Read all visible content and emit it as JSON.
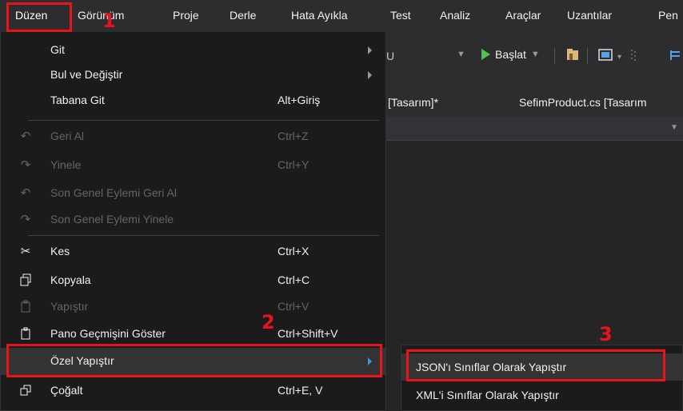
{
  "menubar": {
    "items": [
      "Düzen",
      "Görünüm",
      "Proje",
      "Derle",
      "Hata Ayıkla",
      "Test",
      "Analiz",
      "Araçlar",
      "Uzantılar",
      "Pen"
    ]
  },
  "toolbar": {
    "config_combo_text": "U",
    "start_label": "Başlat"
  },
  "tabs": [
    "[Tasarım]*",
    "SefimProduct.cs [Tasarım"
  ],
  "edit_menu": {
    "items": [
      {
        "label": "Git",
        "shortcut": "",
        "submenu": true,
        "enabled": true,
        "icon": ""
      },
      {
        "label": "Bul ve Değiştir",
        "shortcut": "",
        "submenu": true,
        "enabled": true,
        "icon": ""
      },
      {
        "label": "Tabana Git",
        "shortcut": "Alt+Giriş",
        "submenu": false,
        "enabled": true,
        "icon": ""
      },
      {
        "label": "Geri Al",
        "shortcut": "Ctrl+Z",
        "submenu": false,
        "enabled": false,
        "icon": "undo-icon"
      },
      {
        "label": "Yinele",
        "shortcut": "Ctrl+Y",
        "submenu": false,
        "enabled": false,
        "icon": "redo-icon"
      },
      {
        "label": "Son Genel Eylemi Geri Al",
        "shortcut": "",
        "submenu": false,
        "enabled": false,
        "icon": "undo-icon"
      },
      {
        "label": "Son Genel Eylemi Yinele",
        "shortcut": "",
        "submenu": false,
        "enabled": false,
        "icon": "redo-icon"
      },
      {
        "label": "Kes",
        "shortcut": "Ctrl+X",
        "submenu": false,
        "enabled": true,
        "icon": "scissors-icon"
      },
      {
        "label": "Kopyala",
        "shortcut": "Ctrl+C",
        "submenu": false,
        "enabled": true,
        "icon": "copy-icon"
      },
      {
        "label": "Yapıştır",
        "shortcut": "Ctrl+V",
        "submenu": false,
        "enabled": false,
        "icon": "paste-icon"
      },
      {
        "label": "Pano Geçmişini Göster",
        "shortcut": "Ctrl+Shift+V",
        "submenu": false,
        "enabled": true,
        "icon": "clipboard-icon"
      },
      {
        "label": "Özel Yapıştır",
        "shortcut": "",
        "submenu": true,
        "enabled": true,
        "icon": "",
        "highlighted": true
      },
      {
        "label": "Çoğalt",
        "shortcut": "Ctrl+E, V",
        "submenu": false,
        "enabled": true,
        "icon": "duplicate-icon"
      }
    ]
  },
  "paste_special_submenu": {
    "items": [
      "JSON'ı Sınıflar Olarak Yapıştır",
      "XML'i Sınıflar Olarak Yapıştır"
    ]
  },
  "annotations": {
    "step1": "1",
    "step2": "2",
    "step3": "3",
    "color": "#e8141b"
  }
}
